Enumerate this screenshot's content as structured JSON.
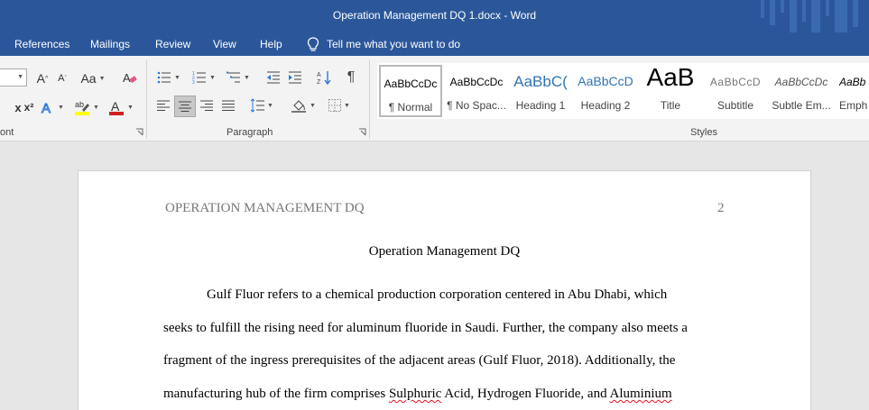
{
  "window": {
    "title": "Operation Management DQ 1.docx  -  Word"
  },
  "tabs": [
    {
      "label": "References"
    },
    {
      "label": "Mailings"
    },
    {
      "label": "Review"
    },
    {
      "label": "View"
    },
    {
      "label": "Help"
    }
  ],
  "tell_me": {
    "text": "Tell me what you want to do"
  },
  "ribbon": {
    "font_group_label": "ont",
    "paragraph_group_label": "Paragraph",
    "styles_group_label": "Styles",
    "styles": [
      {
        "preview": "AaBbCcDc",
        "name": "¶ Normal"
      },
      {
        "preview": "AaBbCcDc",
        "name": "¶ No Spac..."
      },
      {
        "preview": "AaBbC(",
        "name": "Heading 1"
      },
      {
        "preview": "AaBbCcD",
        "name": "Heading 2"
      },
      {
        "preview": "AaB",
        "name": "Title"
      },
      {
        "preview": "AaBbCcD",
        "name": "Subtitle"
      },
      {
        "preview": "AaBbCcDc",
        "name": "Subtle Em..."
      },
      {
        "preview": "AaBb",
        "name": "Emph"
      }
    ],
    "font_grow_label": "A",
    "font_shrink_label": "A",
    "change_case_label": "Aa",
    "superscript_label": "x²",
    "subscript_label": "x"
  },
  "document": {
    "running_head": "OPERATION MANAGEMENT DQ",
    "page_number": "2",
    "title": "Operation Management DQ",
    "lines": [
      "Gulf Fluor refers to a chemical production corporation centered in Abu Dhabi, which",
      "seeks to fulfill the rising need for aluminum fluoride in Saudi. Further, the company also meets a",
      "fragment of the ingress prerequisites of the adjacent areas (Gulf Fluor, 2018). Additionally, the"
    ],
    "line4": {
      "part1": "manufacturing hub of the firm comprises ",
      "misspelled1": "Sulphuric",
      "part2": " Acid, Hydrogen Fluoride, and ",
      "misspelled2": "Aluminium"
    }
  },
  "colors": {
    "title_bar": "#2b579a",
    "ribbon_bg": "#f3f3f3",
    "canvas": "#e6e6e6",
    "font_color_red": "#d02020",
    "highlight_yellow": "#ffff00",
    "heading_blue": "#2e74b5",
    "spelling_error": "#e81123"
  },
  "icons": [
    "lightbulb-icon",
    "bullets-icon",
    "numbering-icon",
    "multilevel-list-icon",
    "decrease-indent-icon",
    "increase-indent-icon",
    "sort-icon",
    "pilcrow-icon",
    "align-left-icon",
    "align-center-icon",
    "align-right-icon",
    "justify-icon",
    "line-spacing-icon",
    "shading-icon",
    "borders-icon",
    "clear-formatting-icon",
    "text-effects-icon",
    "highlight-icon",
    "font-color-icon",
    "dialog-launcher-icon"
  ]
}
